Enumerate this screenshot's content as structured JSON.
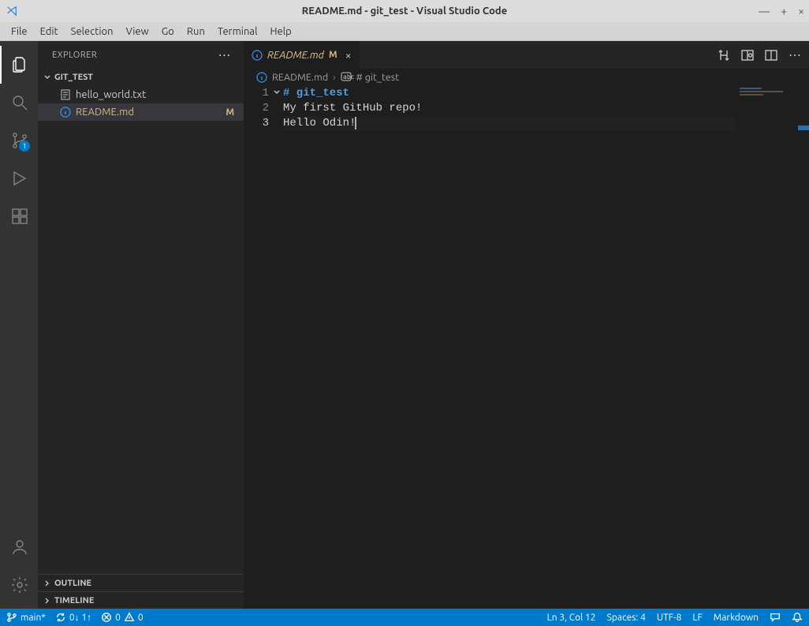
{
  "window": {
    "title": "README.md - git_test - Visual Studio Code"
  },
  "menubar": [
    "File",
    "Edit",
    "Selection",
    "View",
    "Go",
    "Run",
    "Terminal",
    "Help"
  ],
  "activitybar": {
    "scm_badge": "1"
  },
  "sidebar": {
    "title": "EXPLORER",
    "project": "GIT_TEST",
    "files": [
      {
        "name": "hello_world.txt",
        "modified": false,
        "selected": false,
        "icon": "text"
      },
      {
        "name": "README.md",
        "modified": true,
        "selected": true,
        "icon": "info"
      }
    ],
    "outline": "OUTLINE",
    "timeline": "TIMELINE"
  },
  "tabs": {
    "open": [
      {
        "name": "README.md",
        "modified_marker": "M",
        "icon": "info"
      }
    ]
  },
  "breadcrumbs": {
    "file": "README.md",
    "symbol": "# git_test"
  },
  "editor": {
    "lines": [
      {
        "n": "1",
        "text": "# git_test",
        "type": "heading"
      },
      {
        "n": "2",
        "text": "My first GitHub repo!",
        "type": "text"
      },
      {
        "n": "3",
        "text": "Hello Odin!",
        "type": "text",
        "current": true
      }
    ]
  },
  "statusbar": {
    "branch": "main*",
    "sync": "0↓ 1↑",
    "errors": "0",
    "warnings": "0",
    "cursor": "Ln 3, Col 12",
    "spaces": "Spaces: 4",
    "encoding": "UTF-8",
    "eol": "LF",
    "language": "Markdown"
  }
}
